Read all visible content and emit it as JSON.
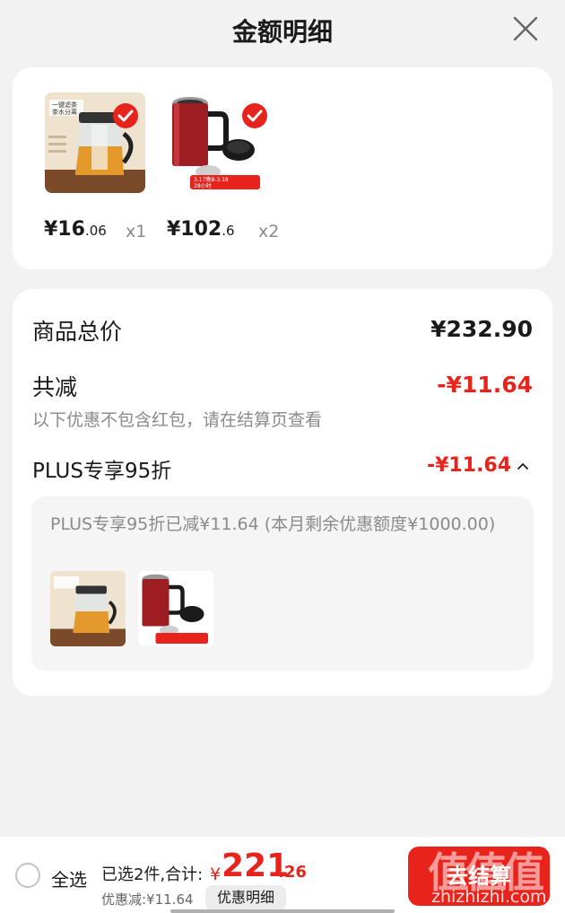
{
  "header": {
    "title": "金额明细"
  },
  "products": [
    {
      "price_int": "¥16",
      "price_dec": ".06",
      "qty": "x1",
      "tag_line1": "一键滤茶",
      "tag_line2": "茶水分离"
    },
    {
      "price_int": "¥102",
      "price_dec": ".6",
      "qty": "x2",
      "tag_line1": "3.17晚8-3.18",
      "tag_line2": "28小时"
    }
  ],
  "details": {
    "total_label": "商品总价",
    "total_amount": "¥232.90",
    "reduce_label": "共减",
    "reduce_amount": "-¥11.64",
    "note": "以下优惠不包含红包，请在结算页查看",
    "plus_label": "PLUS专享95折",
    "plus_amount": "-¥11.64",
    "plus_detail": "PLUS专享95折已减¥11.64 (本月剩余优惠额度¥1000.00)"
  },
  "bottom": {
    "select_all": "全选",
    "summary": "已选2件,合计:",
    "currency": "¥",
    "total_int": "221",
    "total_dec": ".26",
    "discount_note": "优惠减:¥11.64",
    "detail_button": "优惠明细",
    "checkout_button": "去结算",
    "watermark_glyphs": "值值值",
    "watermark_url": "zhizhizhi.com"
  },
  "colors": {
    "accent": "#e8231c",
    "muted": "#8a8a8a",
    "background": "#f2f2f2"
  },
  "icons": {
    "close": "close-icon",
    "check": "check-icon",
    "chevron": "chevron-up-icon"
  }
}
